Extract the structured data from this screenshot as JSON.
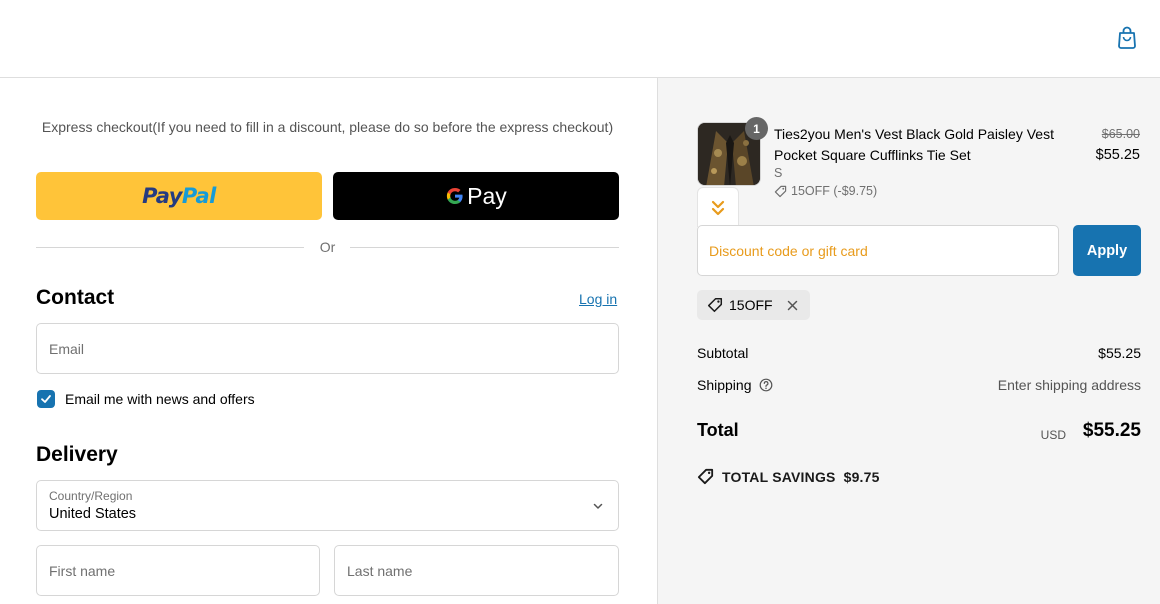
{
  "header": {
    "cart_icon": "shopping-bag-icon"
  },
  "express": {
    "title": "Express checkout(If you need to fill in a discount, please do so before the express checkout)",
    "paypal_label_1": "Pay",
    "paypal_label_2": "Pal",
    "gpay_label": "Pay",
    "or_label": "Or"
  },
  "contact": {
    "title": "Contact",
    "login_label": "Log in",
    "email_placeholder": "Email",
    "newsletter_label": "Email me with news and offers",
    "newsletter_checked": true
  },
  "delivery": {
    "title": "Delivery",
    "country_label": "Country/Region",
    "country_value": "United States",
    "first_name_placeholder": "First name",
    "last_name_placeholder": "Last name"
  },
  "order": {
    "quantity": "1",
    "product_name": "Ties2you Men's Vest Black Gold Paisley Vest Pocket Square Cufflinks Tie Set",
    "variant": "S",
    "discount_line": "15OFF (-$9.75)",
    "original_price": "$65.00",
    "price": "$55.25"
  },
  "discount": {
    "placeholder": "Discount code or gift card",
    "apply_label": "Apply",
    "applied_code": "15OFF"
  },
  "summary": {
    "subtotal_label": "Subtotal",
    "subtotal_value": "$55.25",
    "shipping_label": "Shipping",
    "shipping_value": "Enter shipping address",
    "total_label": "Total",
    "currency": "USD",
    "total_value": "$55.25",
    "savings_label": "TOTAL SAVINGS",
    "savings_value": "$9.75"
  },
  "colors": {
    "accent": "#1773b0",
    "paypal_yellow": "#ffc439",
    "placeholder_orange": "#e89b1c"
  }
}
